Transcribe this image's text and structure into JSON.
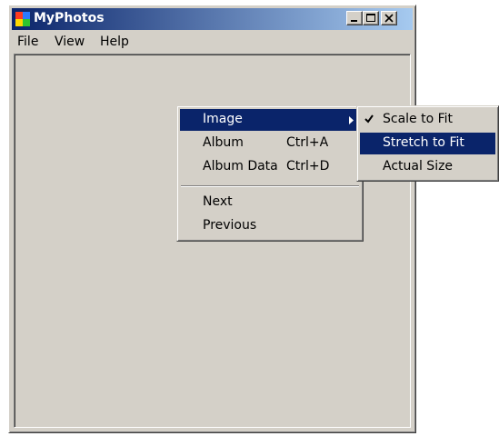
{
  "window": {
    "title": "MyPhotos",
    "title_icon": "app-photos-icon",
    "controls": [
      "minimize-icon",
      "maximize-icon",
      "close-icon"
    ]
  },
  "menubar": {
    "items": [
      "File",
      "View",
      "Help"
    ]
  },
  "context_menu": {
    "items": [
      {
        "label": "Image",
        "shortcut": "",
        "submenu": true,
        "highlighted": true
      },
      {
        "label": "Album",
        "shortcut": "Ctrl+A"
      },
      {
        "label": "Album Data",
        "shortcut": "Ctrl+D"
      },
      {
        "label": "Next",
        "shortcut": ""
      },
      {
        "label": "Previous",
        "shortcut": ""
      }
    ]
  },
  "submenu": {
    "items": [
      {
        "label": "Scale to Fit",
        "checked": true
      },
      {
        "label": "Stretch to Fit",
        "highlighted": true
      },
      {
        "label": "Actual Size"
      }
    ]
  },
  "colors": {
    "face": "#d4d0c8",
    "highlight": "#0a246a",
    "title_gradient_end": "#a6caf0"
  }
}
